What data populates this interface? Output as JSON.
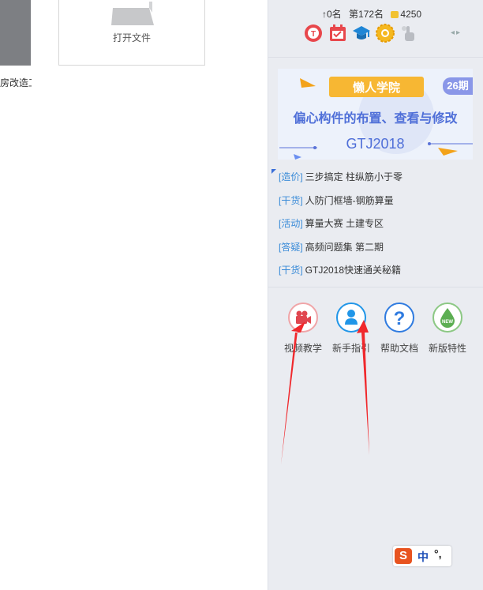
{
  "left_area": {
    "project_label": "房改造工",
    "open_file_label": "打开文件"
  },
  "panel": {
    "stats": {
      "rank_change": "↑0名",
      "rank": "第172名",
      "coins": "4250"
    },
    "badge_icons": [
      "t-medal-icon",
      "calendar-check-icon",
      "graduation-cap-icon",
      "gear-medal-icon",
      "touch-hand-icon"
    ],
    "banner": {
      "brand": "懒人学院",
      "period": "26期",
      "title": "偏心构件的布置、查看与修改",
      "product": "GTJ2018"
    },
    "news": [
      {
        "tag": "[造价]",
        "text": "三步搞定 柱纵筋小于零"
      },
      {
        "tag": "[干货]",
        "text": "人防门框墙-钢筋算量"
      },
      {
        "tag": "[活动]",
        "text": "算量大赛 土建专区"
      },
      {
        "tag": "[答疑]",
        "text": "高频问题集 第二期"
      },
      {
        "tag": "[干货]",
        "text": "GTJ2018快速通关秘籍"
      }
    ],
    "tools": [
      {
        "label": "视频教学",
        "icon": "video-camera-icon",
        "color": "#e0464f"
      },
      {
        "label": "新手指引",
        "icon": "user-guide-icon",
        "color": "#2196e8"
      },
      {
        "label": "帮助文档",
        "icon": "help-question-icon",
        "color": "#2f7be0"
      },
      {
        "label": "新版特性",
        "icon": "new-feature-drop-icon",
        "color": "#5cae52"
      }
    ]
  },
  "ime": {
    "mode": "中",
    "punct": "°,"
  },
  "colors": {
    "panel_bg": "#eaecf1",
    "tag_blue": "#3a8bd8",
    "annotation_red": "#f0282c"
  }
}
